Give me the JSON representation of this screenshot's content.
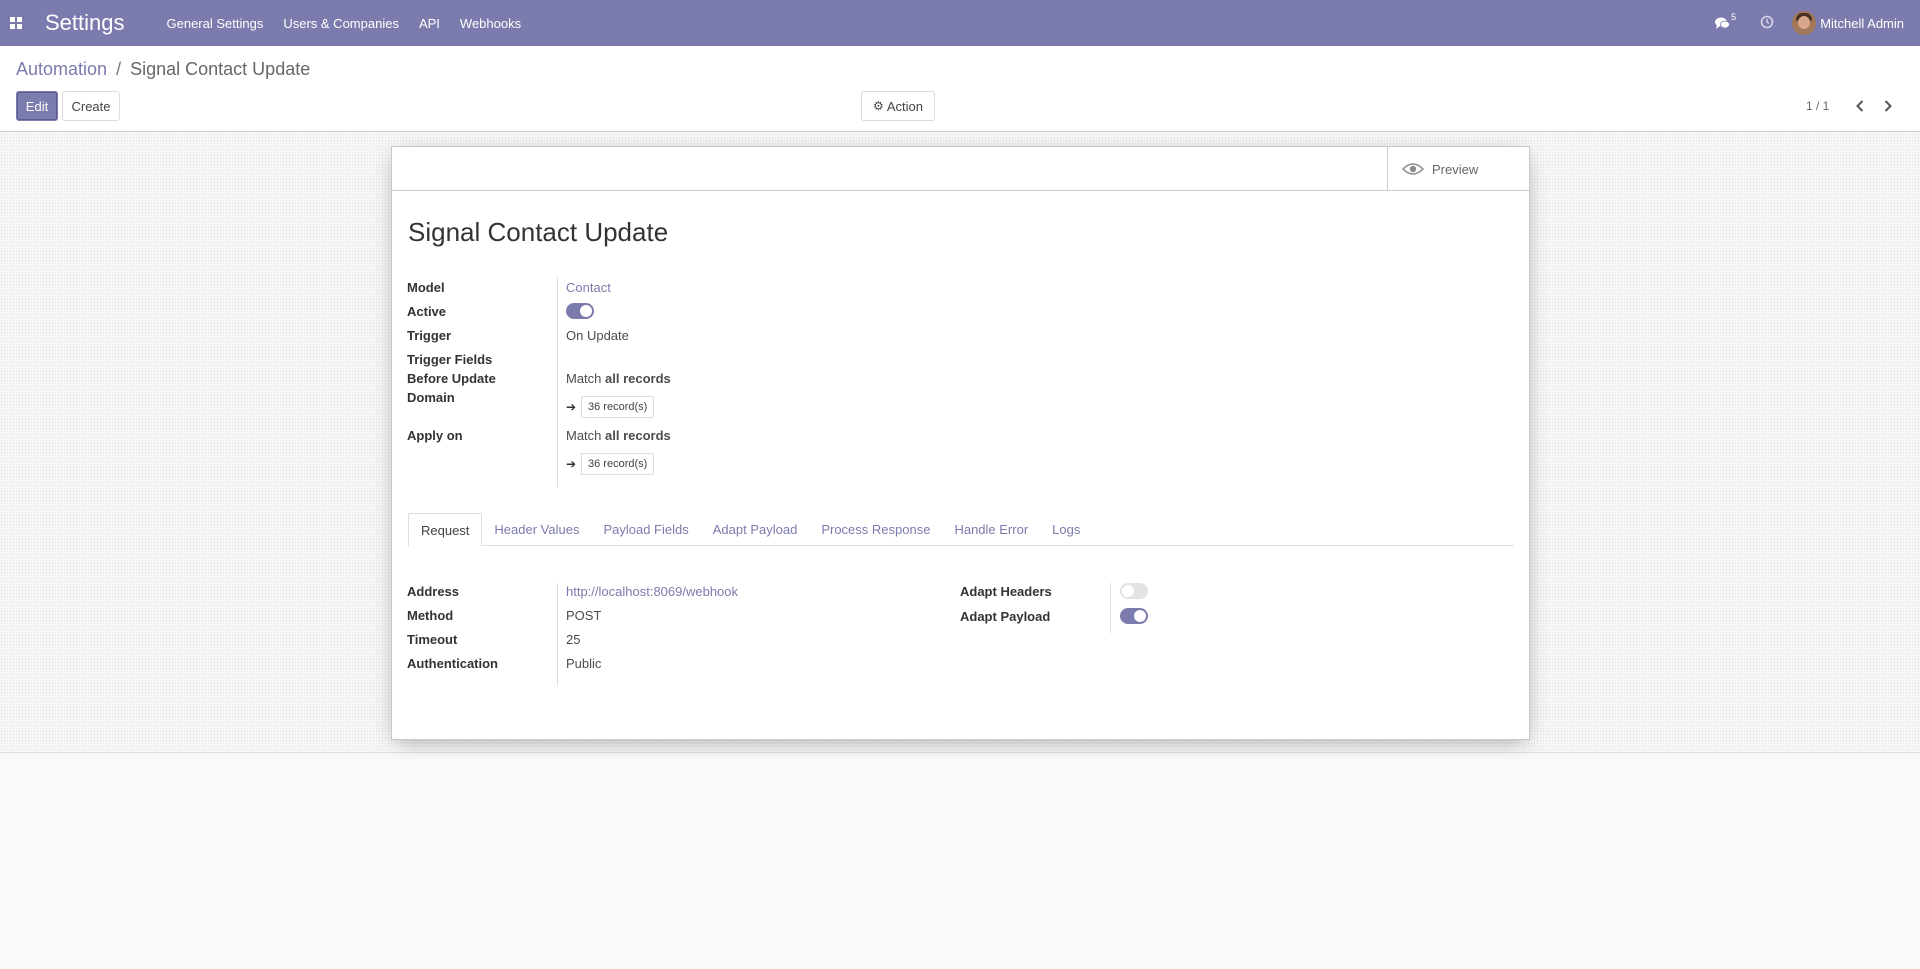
{
  "navbar": {
    "app_title": "Settings",
    "menu": [
      "General Settings",
      "Users & Companies",
      "API",
      "Webhooks"
    ],
    "chat_count": "5",
    "user_name": "Mitchell Admin",
    "accent_color": "#7c7bad"
  },
  "breadcrumb": {
    "parent": "Automation",
    "separator": "/",
    "current": "Signal Contact Update"
  },
  "toolbar": {
    "edit_label": "Edit",
    "create_label": "Create",
    "action_label": "Action",
    "pager_text": "1 / 1"
  },
  "sheet": {
    "preview_label": "Preview",
    "title": "Signal Contact Update",
    "fields": {
      "model_label": "Model",
      "model_value": "Contact",
      "active_label": "Active",
      "active_value": true,
      "trigger_label": "Trigger",
      "trigger_value": "On Update",
      "trigger_fields_label": "Trigger Fields",
      "before_update_label_1": "Before Update",
      "before_update_label_2": "Domain",
      "before_match_prefix": "Match",
      "before_match_bold": "all records",
      "before_records": "36 record(s)",
      "apply_on_label": "Apply on",
      "apply_match_prefix": "Match",
      "apply_match_bold": "all records",
      "apply_records": "36 record(s)"
    },
    "tabs": [
      {
        "label": "Request",
        "active": true
      },
      {
        "label": "Header Values",
        "active": false
      },
      {
        "label": "Payload Fields",
        "active": false
      },
      {
        "label": "Adapt Payload",
        "active": false
      },
      {
        "label": "Process Response",
        "active": false
      },
      {
        "label": "Handle Error",
        "active": false
      },
      {
        "label": "Logs",
        "active": false
      }
    ],
    "request": {
      "address_label": "Address",
      "address_value": "http://localhost:8069/webhook",
      "method_label": "Method",
      "method_value": "POST",
      "timeout_label": "Timeout",
      "timeout_value": "25",
      "auth_label": "Authentication",
      "auth_value": "Public",
      "adapt_headers_label": "Adapt Headers",
      "adapt_headers_value": false,
      "adapt_payload_label": "Adapt Payload",
      "adapt_payload_value": true
    }
  }
}
